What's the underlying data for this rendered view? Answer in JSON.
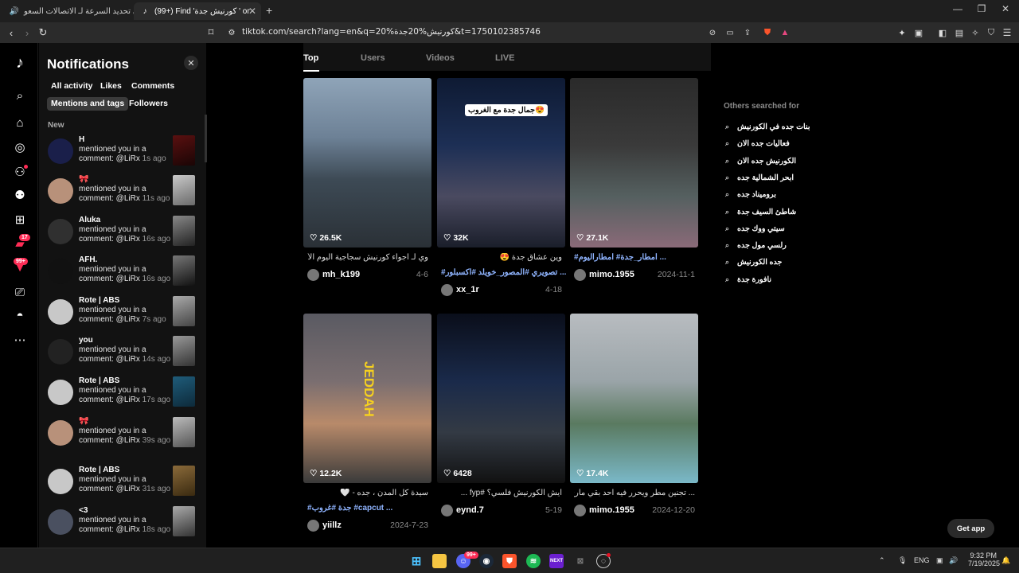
{
  "browser": {
    "tabs": [
      {
        "label": "تخطي تحديد السرعة لـ الاتصالات السعو..."
      },
      {
        "label": "(99+) Find 'كورنيش جدة ' on TikTo..."
      }
    ],
    "url": "tiktok.com/search?lang=en&q=كورنيش%20جدة%20&t=1750102385746"
  },
  "rail": {
    "badges": {
      "messages": "17",
      "activity": "99+"
    }
  },
  "notifications": {
    "title": "Notifications",
    "chips": [
      "All activity",
      "Likes",
      "Comments",
      "Mentions and tags",
      "Followers"
    ],
    "section": "New",
    "items": [
      {
        "name": "H",
        "line1": "mentioned you in a",
        "line2": "comment: @LiRx",
        "time": "1s ago"
      },
      {
        "name": "🎀",
        "line1": "mentioned you in a",
        "line2": "comment: @LiRx",
        "time": "11s ago"
      },
      {
        "name": "Aluka",
        "line1": "mentioned you in a",
        "line2": "comment: @LiRx",
        "time": "16s ago"
      },
      {
        "name": "AFH.",
        "line1": "mentioned you in a",
        "line2": "comment: @LiRx",
        "time": "16s ago"
      },
      {
        "name": "Rote | ABS",
        "line1": "mentioned you in a",
        "line2": "comment: @LiRx",
        "time": "7s ago"
      },
      {
        "name": "you",
        "line1": "mentioned you in a",
        "line2": "comment: @LiRx",
        "time": "14s ago"
      },
      {
        "name": "Rote | ABS",
        "line1": "mentioned you in a",
        "line2": "comment: @LiRx",
        "time": "17s ago"
      },
      {
        "name": "🎀",
        "line1": "mentioned you in a",
        "line2": "comment: @LiRx",
        "time": "39s ago"
      },
      {
        "name": "Rote | ABS",
        "line1": "mentioned you in a",
        "line2": "comment: @LiRx",
        "time": "31s ago"
      },
      {
        "name": "<3",
        "line1": "mentioned you in a",
        "line2": "comment: @LiRx",
        "time": "18s ago"
      }
    ]
  },
  "search": {
    "tabs": [
      "Top",
      "Users",
      "Videos",
      "LIVE"
    ],
    "videos": [
      {
        "likes": "26.5K",
        "caption": "وي لـ اجواء كورنيش سجاجية اليوم الأحد",
        "tags": "",
        "user": "mh_k199",
        "date": "4-6",
        "overlay": ""
      },
      {
        "likes": "32K",
        "caption": "وين عشاق جدة 😍",
        "tags": "#تصويري #المصور_خويلد #اكسبلور ...",
        "user": "xx_1r",
        "date": "4-18",
        "overlay": "جمال جدة مع الغروب😍"
      },
      {
        "likes": "27.1K",
        "caption": "",
        "tags": "#امطار_جدة# امطاراليوم ...",
        "user": "mimo.1955",
        "date": "2024-11-1",
        "overlay": ""
      },
      {
        "likes": "12.2K",
        "caption": "سيدة كل المدن ، جده - 🤍",
        "tags": "#جدة #غروب #capcut ...",
        "user": "yiillz",
        "date": "2024-7-23",
        "overlay": ""
      },
      {
        "likes": "6428",
        "caption": "ايش الكورنيش فلسي؟ #fyp ...",
        "tags": "",
        "user": "eynd.7",
        "date": "5-19",
        "overlay": ""
      },
      {
        "likes": "17.4K",
        "caption": "... تجنين مطر ويحرر فيه احد بقي مارح ؟",
        "tags": "",
        "user": "mimo.1955",
        "date": "2024-12-20",
        "overlay": ""
      }
    ],
    "others_title": "Others searched for",
    "suggestions": [
      "بنات جده في الكورنيش",
      "فعاليات جده الان",
      "الكورنيش جده الان",
      "ابحر الشمالية جده",
      "بروميناد جده",
      "شاطئ السيف جدة",
      "سيتي ووك جده",
      "رلسي مول جده",
      "جده الكورنيش",
      "نافورة جدة"
    ],
    "get_app": "Get app"
  },
  "taskbar": {
    "lang": "ENG",
    "time": "9:32 PM",
    "date": "7/19/2025",
    "discord_badge": "99+"
  },
  "colors": {
    "accent": "#fe2c55",
    "panel": "#121212",
    "hashtag": "#8fb4ff"
  }
}
